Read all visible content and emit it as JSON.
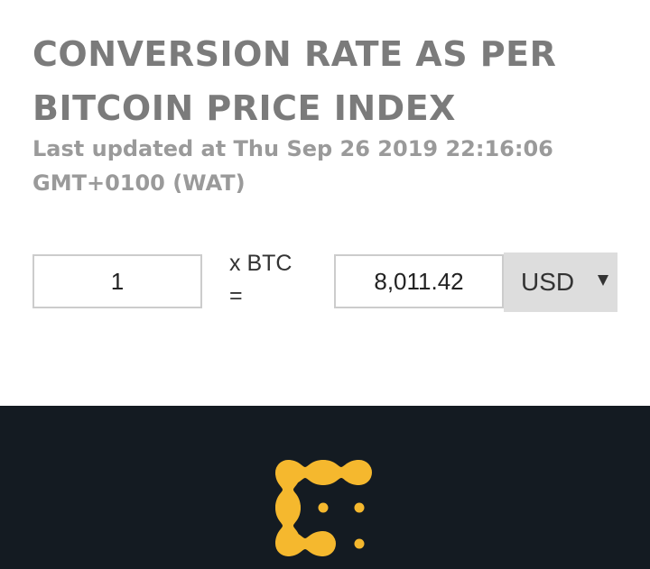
{
  "header": {
    "title": "CONVERSION RATE AS PER BITCOIN PRICE INDEX",
    "last_updated": "Last updated at Thu Sep 26 2019 22:16:06 GMT+0100 (WAT)"
  },
  "converter": {
    "amount_value": "1",
    "multiplier_label": "x BTC =",
    "result_value": "8,011.42",
    "currency_selected": "USD"
  },
  "footer": {
    "background": "#141b22",
    "logo_color": "#f5b82e",
    "logo_icon": "coinmarket-logo-icon"
  }
}
